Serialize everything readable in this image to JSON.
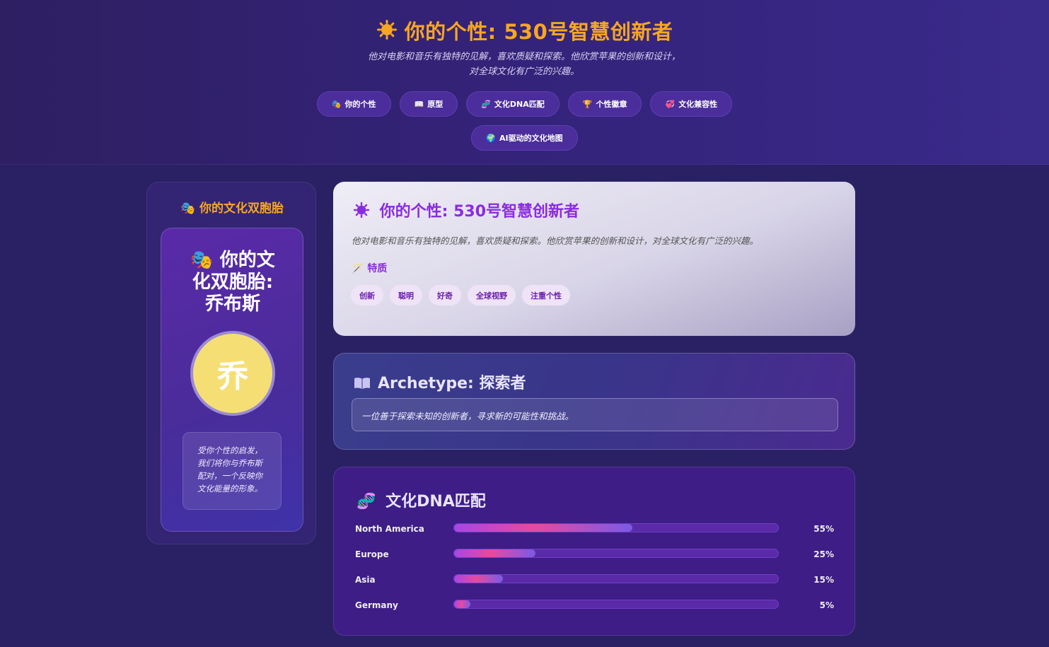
{
  "colors": {
    "accent_orange": "#f6a623",
    "accent_purple": "#8a2be2",
    "avatar_yellow": "#f5df74"
  },
  "header": {
    "title": "你的个性: 530号智慧创新者",
    "description_line1": "他对电影和音乐有独特的见解，喜欢质疑和探索。他欣赏苹果的创新和设计，",
    "description_line2": "对全球文化有广泛的兴趣。"
  },
  "nav": {
    "items": [
      {
        "icon": "🎭",
        "label": "你的个性"
      },
      {
        "icon": "📖",
        "label": "原型"
      },
      {
        "icon": "🧬",
        "label": "文化DNA匹配"
      },
      {
        "icon": "🏆",
        "label": "个性徽章"
      },
      {
        "icon": "💞",
        "label": "文化兼容性"
      },
      {
        "icon": "🌍",
        "label": "AI驱动的文化地图"
      }
    ]
  },
  "twin": {
    "heading": "你的文化双胞胎",
    "name_line1": "你的文",
    "name_line2": "化双胞胎:",
    "name_line3": "乔布斯",
    "avatar_char": "乔",
    "note": "受你个性的启发，我们将你与乔布斯配对，一个反映你文化能量的形象。"
  },
  "personality": {
    "title": "你的个性: 530号智慧创新者",
    "description": "他对电影和音乐有独特的见解，喜欢质疑和探索。他欣赏苹果的创新和设计，对全球文化有广泛的兴趣。",
    "traits_label": "特质",
    "traits": [
      "创新",
      "聪明",
      "好奇",
      "全球视野",
      "注重个性"
    ]
  },
  "archetype": {
    "title": "Archetype: 探索者",
    "description": "一位善于探索未知的创新者，寻求新的可能性和挑战。"
  },
  "dna": {
    "title": "文化DNA匹配",
    "rows": [
      {
        "region": "North America",
        "value": 55,
        "label": "55%"
      },
      {
        "region": "Europe",
        "value": 25,
        "label": "25%"
      },
      {
        "region": "Asia",
        "value": 15,
        "label": "15%"
      },
      {
        "region": "Germany",
        "value": 5,
        "label": "5%"
      }
    ]
  }
}
